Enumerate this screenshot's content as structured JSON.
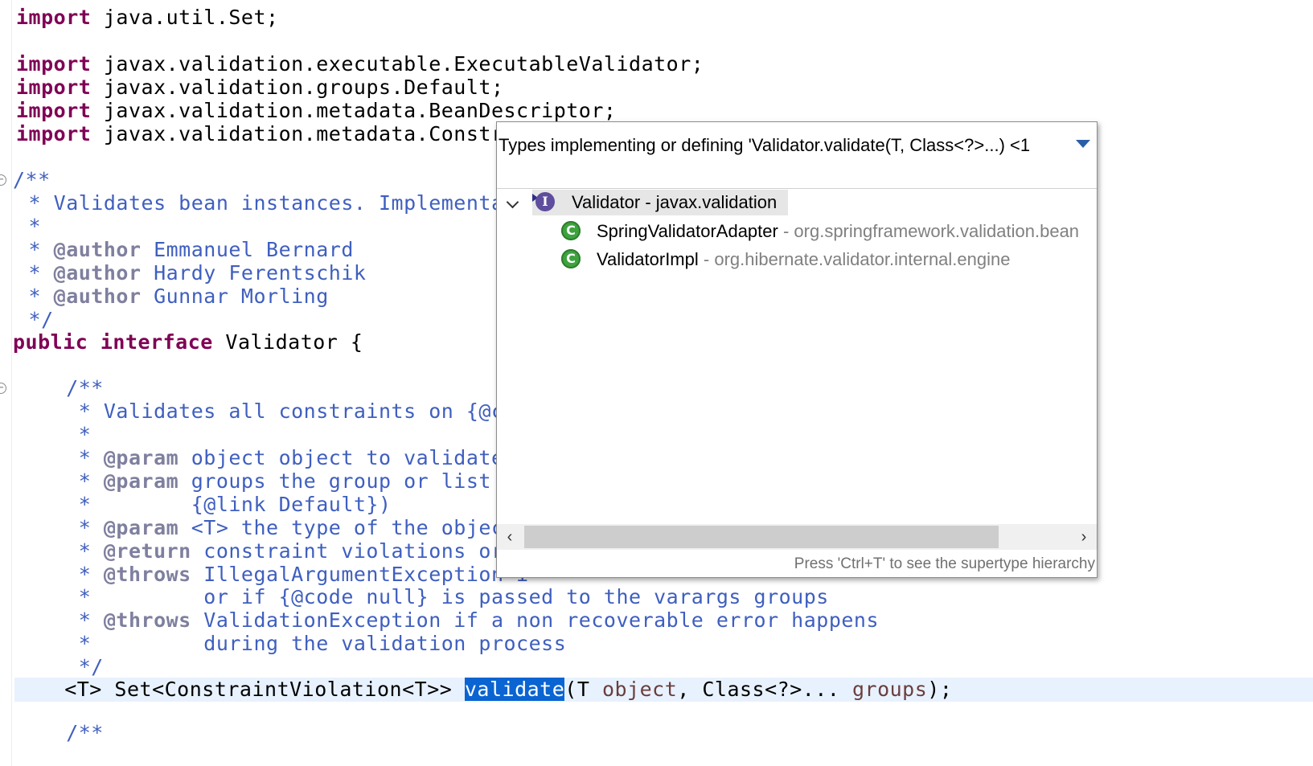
{
  "editor": {
    "lines": {
      "l1": {
        "kw": "import",
        "rest": " java.util.Set;"
      },
      "l3": {
        "kw": "import",
        "rest": " javax.validation.executable.ExecutableValidator;"
      },
      "l4": {
        "kw": "import",
        "rest": " javax.validation.groups.Default;"
      },
      "l5": {
        "kw": "import",
        "rest": " javax.validation.metadata.BeanDescriptor;"
      },
      "l6": {
        "kw": "import",
        "rest": " javax.validation.metadata.Constrai"
      },
      "l8": {
        "text": "/**"
      },
      "l9": {
        "text": " * Validates bean instances. Implementatio"
      },
      "l10": {
        "text": " *"
      },
      "l11": {
        "prefix": " * ",
        "tag": "@author",
        "text": " Emmanuel Bernard"
      },
      "l12": {
        "prefix": " * ",
        "tag": "@author",
        "text": " Hardy Ferentschik"
      },
      "l13": {
        "prefix": " * ",
        "tag": "@author",
        "text": " Gunnar Morling"
      },
      "l14": {
        "text": " */"
      },
      "l15": {
        "kw1": "public",
        "kw2": "interface",
        "rest": " Validator {"
      },
      "l17": {
        "text": "    /**"
      },
      "l18": {
        "text": "     * Validates all constraints on {@code"
      },
      "l19": {
        "text": "     *"
      },
      "l20": {
        "prefix": "     * ",
        "tag": "@param",
        "text": " object object to validate"
      },
      "l21": {
        "prefix": "     * ",
        "tag": "@param",
        "text": " groups the group or list of"
      },
      "l22": {
        "text": "     *        {@link Default})"
      },
      "l23": {
        "prefix": "     * ",
        "tag": "@param",
        "text": " <T> the type of the object"
      },
      "l24": {
        "prefix": "     * ",
        "tag": "@return",
        "text": " constraint violations or a"
      },
      "l25": {
        "prefix": "     * ",
        "tag": "@throws",
        "text": " IllegalArgumentException i"
      },
      "l26": {
        "text": "     *         or if {@code null} is passed to the varargs groups"
      },
      "l27": {
        "prefix": "     * ",
        "tag": "@throws",
        "text": " ValidationException if a non recoverable error happens"
      },
      "l28": {
        "text": "     *         during the validation process"
      },
      "l29": {
        "text": "     */"
      },
      "l30": {
        "pre": "    <T> Set<ConstraintViolation<T>> ",
        "selected": "validate",
        "mid1": "(T ",
        "p1": "object",
        "mid2": ", Class<?>... ",
        "p2": "groups",
        "end": ");"
      },
      "l32": {
        "text": "    /**"
      }
    }
  },
  "popup": {
    "title": "Types implementing or defining 'Validator.validate(T, Class<?>...) <1",
    "root": {
      "icon": "interface-icon",
      "icon_glyph": "I",
      "name": "Validator",
      "sep": " - ",
      "package": "javax.validation"
    },
    "children": [
      {
        "icon": "class-icon",
        "icon_glyph": "C",
        "name": "SpringValidatorAdapter",
        "sep": " - ",
        "package": "org.springframework.validation.bean"
      },
      {
        "icon": "class-icon",
        "icon_glyph": "C",
        "name": "ValidatorImpl",
        "sep": " - ",
        "package": "org.hibernate.validator.internal.engine"
      }
    ],
    "scroll_left": "‹",
    "scroll_right": "›",
    "status": "Press 'Ctrl+T' to see the supertype hierarchy"
  },
  "colors": {
    "keyword": "#7f0055",
    "javadoc": "#3f5fbf",
    "javadoc_tag": "#7f7f9f",
    "selection": "#0a64d2",
    "current_line": "#e8f2fe"
  }
}
